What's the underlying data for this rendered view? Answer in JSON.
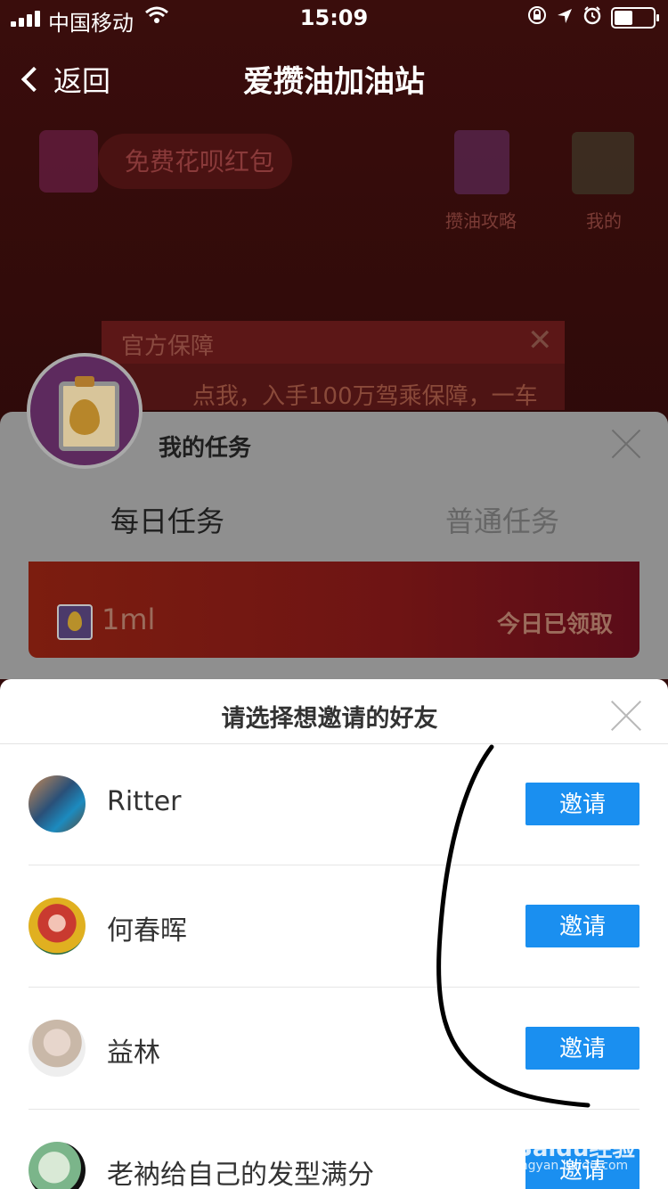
{
  "status_bar": {
    "carrier": "中国移动",
    "time": "15:09"
  },
  "nav": {
    "back_label": "返回",
    "title": "爱攒油加油站"
  },
  "background": {
    "promo_label": "免费花呗红包",
    "guide_label": "攒油攻略",
    "mine_label": "我的",
    "banner_title": "官方保障",
    "banner_text": "点我，入手100万驾乘保障，一车"
  },
  "task_panel": {
    "title": "我的任务",
    "tabs": [
      "每日任务",
      "普通任务"
    ],
    "reward_value": "1ml",
    "reward_status": "今日已领取"
  },
  "invite_sheet": {
    "title": "请选择想邀请的好友",
    "friends": [
      {
        "name": "Ritter",
        "button": "邀请"
      },
      {
        "name": "何春晖",
        "button": "邀请"
      },
      {
        "name": "益林",
        "button": "邀请"
      },
      {
        "name": "老衲给自己的发型满分",
        "button": "邀请"
      }
    ]
  },
  "watermark": {
    "text": "Baidu经验",
    "sub": "jingyan.baidu.com"
  }
}
